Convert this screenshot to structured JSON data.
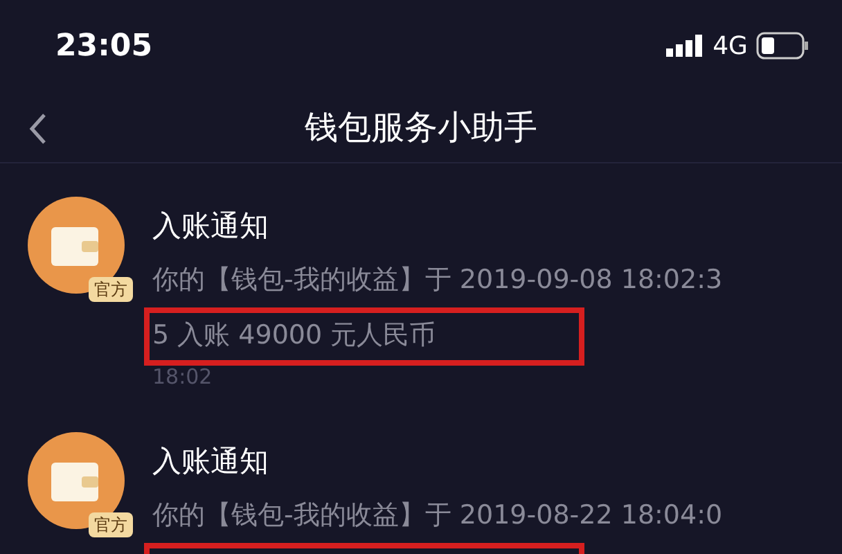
{
  "status_bar": {
    "time": "23:05",
    "network": "4G"
  },
  "nav": {
    "title": "钱包服务小助手"
  },
  "messages": [
    {
      "badge": "官方",
      "title": "入账通知",
      "lines": [
        "你的【钱包-我的收益】于 2019-09-08 18:02:3",
        "5 入账 49000 元人民币"
      ],
      "time": "18:02",
      "highlighted": true
    },
    {
      "badge": "官方",
      "title": "入账通知",
      "lines": [
        "你的【钱包-我的收益】于 2019-08-22 18:04:0"
      ],
      "highlighted": true
    }
  ]
}
